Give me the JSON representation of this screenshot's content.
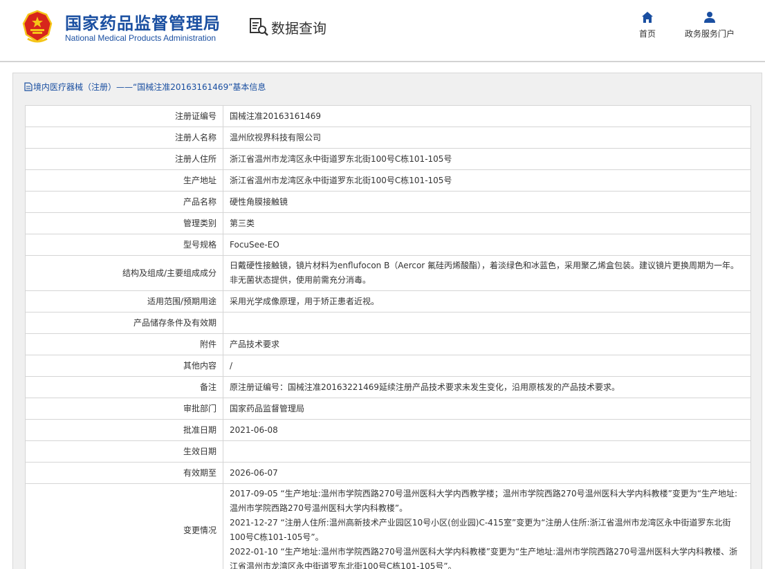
{
  "header": {
    "brand_cn": "国家药品监督管理局",
    "brand_en": "National Medical Products Administration",
    "query_title": "数据查询",
    "nav": [
      {
        "label": "首页",
        "icon": "home-icon"
      },
      {
        "label": "政务服务门户",
        "icon": "user-icon"
      }
    ]
  },
  "panel": {
    "title": "境内医疗器械（注册）——“国械注准20163161469”基本信息"
  },
  "rows": [
    {
      "label": "注册证编号",
      "value": "国械注准20163161469"
    },
    {
      "label": "注册人名称",
      "value": "温州欣视界科技有限公司"
    },
    {
      "label": "注册人住所",
      "value": "浙江省温州市龙湾区永中街道罗东北街100号C栋101-105号"
    },
    {
      "label": "生产地址",
      "value": "浙江省温州市龙湾区永中街道罗东北街100号C栋101-105号"
    },
    {
      "label": "产品名称",
      "value": "硬性角膜接触镜"
    },
    {
      "label": "管理类别",
      "value": "第三类"
    },
    {
      "label": "型号规格",
      "value": "FocuSee-EO"
    },
    {
      "label": "结构及组成/主要组成成分",
      "value": "日戴硬性接触镜，镜片材料为enflufocon B（Aercor 氟硅丙烯酸酯），着淡绿色和冰蓝色，采用聚乙烯盒包装。建议镜片更换周期为一年。非无菌状态提供，使用前需充分消毒。"
    },
    {
      "label": "适用范围/预期用途",
      "value": "采用光学成像原理，用于矫正患者近视。"
    },
    {
      "label": "产品储存条件及有效期",
      "value": ""
    },
    {
      "label": "附件",
      "value": "产品技术要求"
    },
    {
      "label": "其他内容",
      "value": "/"
    },
    {
      "label": "备注",
      "value": "原注册证编号：国械注准20163221469延续注册产品技术要求未发生变化，沿用原核发的产品技术要求。"
    },
    {
      "label": "审批部门",
      "value": "国家药品监督管理局"
    },
    {
      "label": "批准日期",
      "value": "2021-06-08"
    },
    {
      "label": "生效日期",
      "value": ""
    },
    {
      "label": "有效期至",
      "value": "2026-06-07"
    },
    {
      "label": "变更情况",
      "value": ""
    }
  ],
  "changes": [
    "2017-09-05 “生产地址:温州市学院西路270号温州医科大学内西教学楼；温州市学院西路270号温州医科大学内科教楼”变更为“生产地址:温州市学院西路270号温州医科大学内科教楼”。",
    "2021-12-27 “注册人住所:温州高新技术产业园区10号小区(创业园)C-415室”变更为“注册人住所:浙江省温州市龙湾区永中街道罗东北街100号C栋101-105号”。",
    "2022-01-10 “生产地址:温州市学院西路270号温州医科大学内科教楼”变更为“生产地址:温州市学院西路270号温州医科大学内科教楼、浙江省温州市龙湾区永中街道罗东北街100号C栋101-105号”。"
  ],
  "colors": {
    "brand_blue": "#1a4fa1",
    "emblem_red": "#d7261c",
    "emblem_gold": "#f5c518"
  }
}
